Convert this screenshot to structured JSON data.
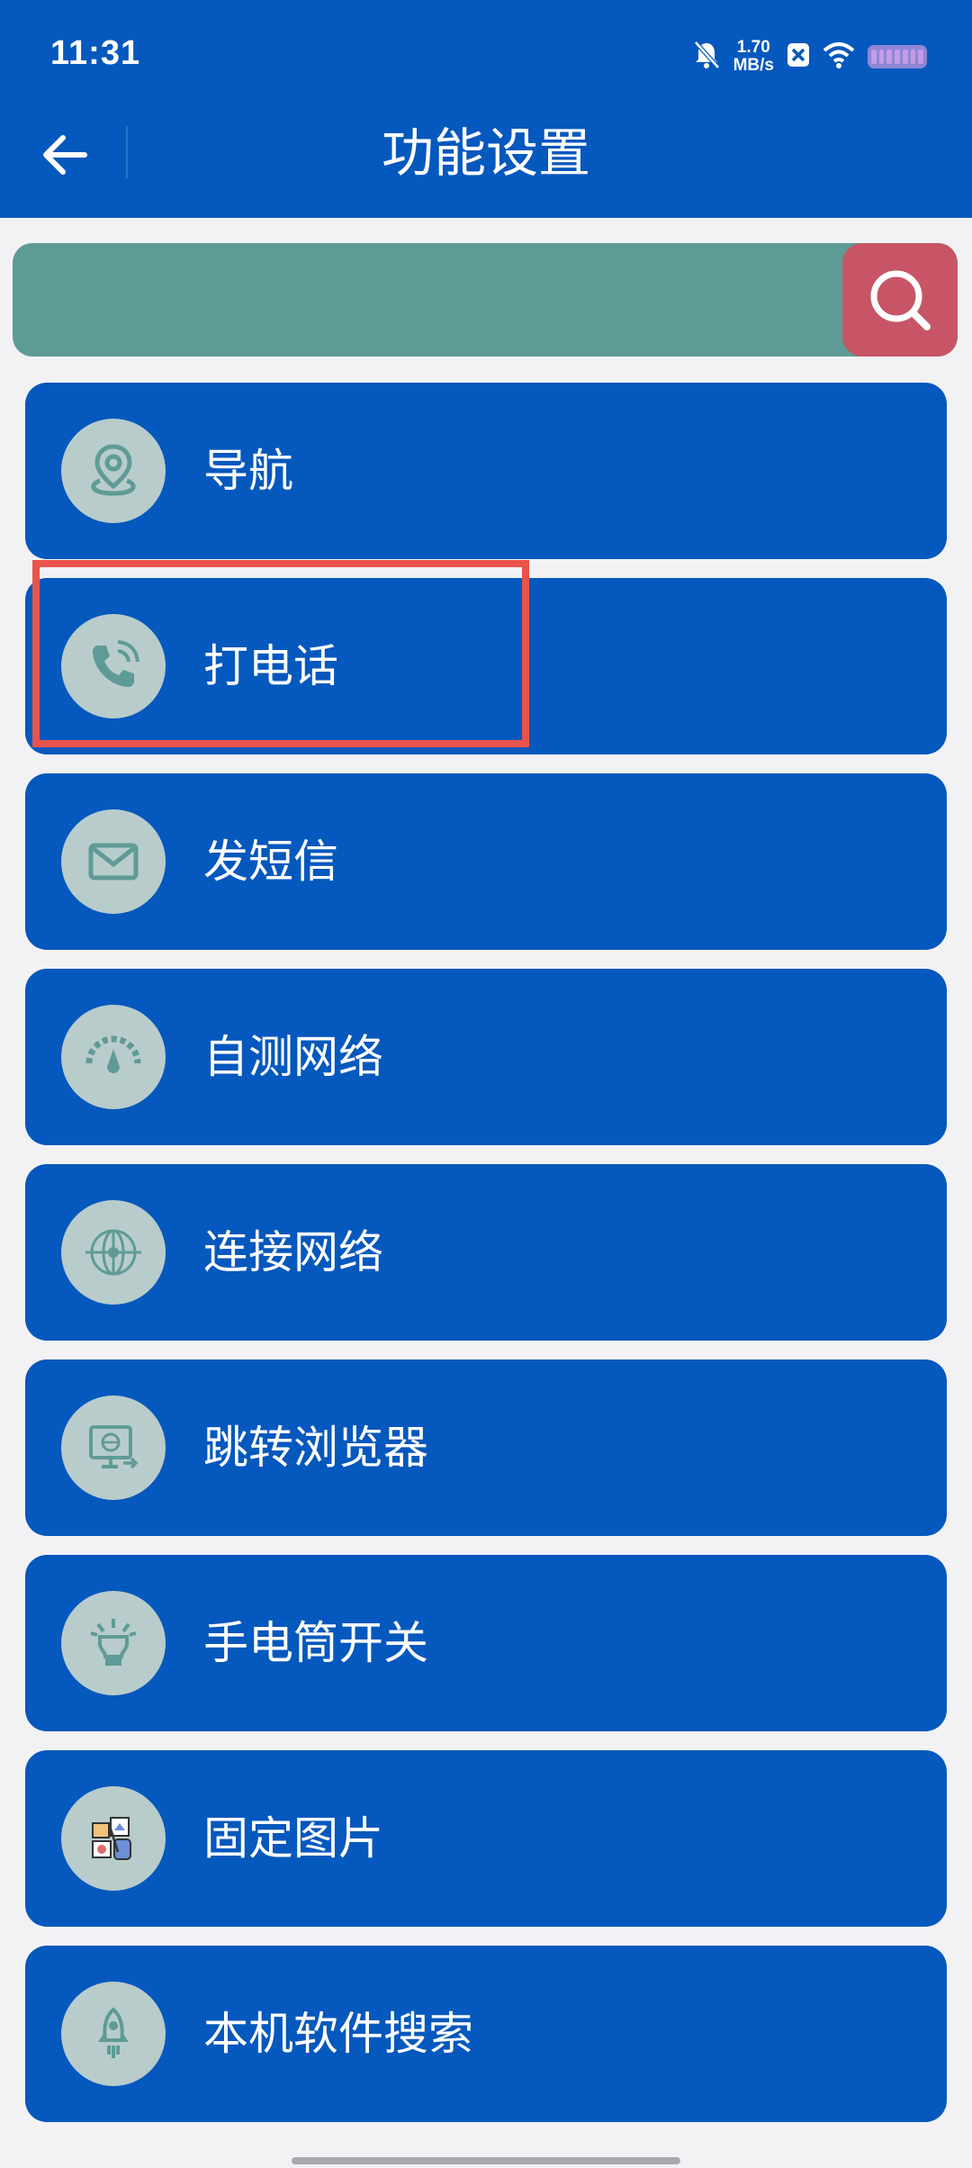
{
  "status": {
    "time": "11:31",
    "net_speed_value": "1.70",
    "net_speed_unit": "MB/s"
  },
  "header": {
    "title": "功能设置"
  },
  "search": {
    "placeholder": "",
    "value": ""
  },
  "items": [
    {
      "label": "导航",
      "icon": "location-pin-icon"
    },
    {
      "label": "打电话",
      "icon": "phone-icon"
    },
    {
      "label": "发短信",
      "icon": "mail-icon"
    },
    {
      "label": "自测网络",
      "icon": "speedometer-icon"
    },
    {
      "label": "连接网络",
      "icon": "globe-network-icon"
    },
    {
      "label": "跳转浏览器",
      "icon": "browser-monitor-icon"
    },
    {
      "label": "手电筒开关",
      "icon": "flashlight-icon"
    },
    {
      "label": "固定图片",
      "icon": "image-collage-icon"
    },
    {
      "label": "本机软件搜索",
      "icon": "rocket-icon"
    }
  ],
  "colors": {
    "header_bg": "#0558bd",
    "item_bg": "#0558bd",
    "search_bg": "#5f9b96",
    "search_button_bg": "#c75565",
    "icon_circle": "#b8cccb",
    "icon_stroke": "#5f9b96",
    "highlight": "#e8534a",
    "page_bg": "#f2f2f5"
  }
}
